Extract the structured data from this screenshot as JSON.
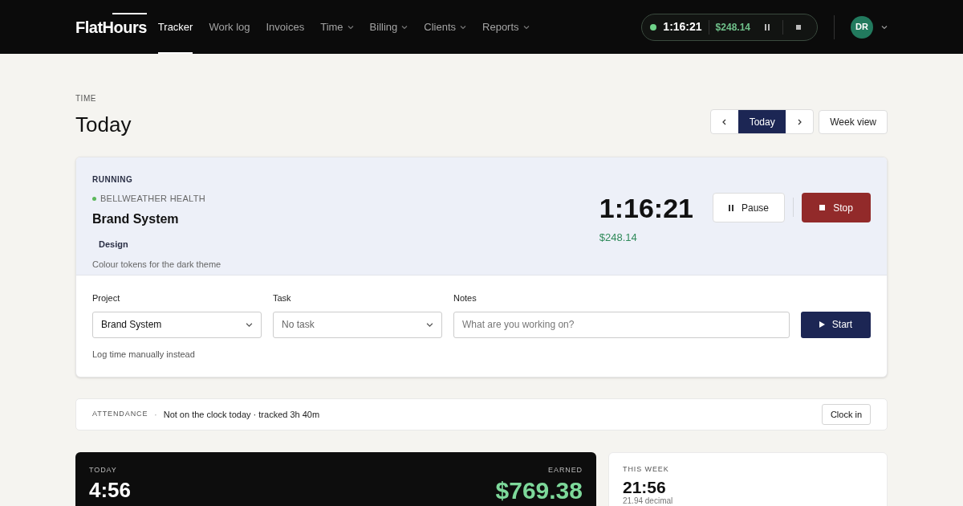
{
  "brand": "FlatHours",
  "nav": [
    {
      "label": "Tracker",
      "selected": true,
      "menu": false
    },
    {
      "label": "Work log",
      "selected": false,
      "menu": false
    },
    {
      "label": "Invoices",
      "selected": false,
      "menu": false
    },
    {
      "label": "Time",
      "selected": false,
      "menu": true
    },
    {
      "label": "Billing",
      "selected": false,
      "menu": true
    },
    {
      "label": "Clients",
      "selected": false,
      "menu": true
    },
    {
      "label": "Reports",
      "selected": false,
      "menu": true
    }
  ],
  "mini_timer": {
    "running": true,
    "time": "1:16:21",
    "amount": "$248.14"
  },
  "user": {
    "initials": "DR"
  },
  "page": {
    "eyebrow": "TIME",
    "title": "Today"
  },
  "date_nav": {
    "today": "Today",
    "week": "Week view"
  },
  "running": {
    "label": "RUNNING",
    "client": "BELLWEATHER HEALTH",
    "project": "Brand System",
    "tag": "Design",
    "note": "Colour tokens for the dark theme",
    "time": "1:16:21",
    "amount": "$248.14",
    "pause": "Pause",
    "stop": "Stop"
  },
  "form": {
    "project_label": "Project",
    "project": "Brand System",
    "task_label": "Task",
    "task": "No task",
    "notes_label": "Notes",
    "notes_placeholder": "What are you working on?",
    "start": "Start",
    "manual": "Log time manually instead"
  },
  "attendance": {
    "label": "ATTENDANCE",
    "sep": "·",
    "text": "Not on the clock today · tracked 3h 40m",
    "button": "Clock in"
  },
  "today_card": {
    "label": "TODAY",
    "value": "4:56",
    "earned_label": "EARNED",
    "earned": "$769.38"
  },
  "week_card": {
    "label": "THIS WEEK",
    "value": "21:56",
    "sub": "21.94 decimal"
  }
}
